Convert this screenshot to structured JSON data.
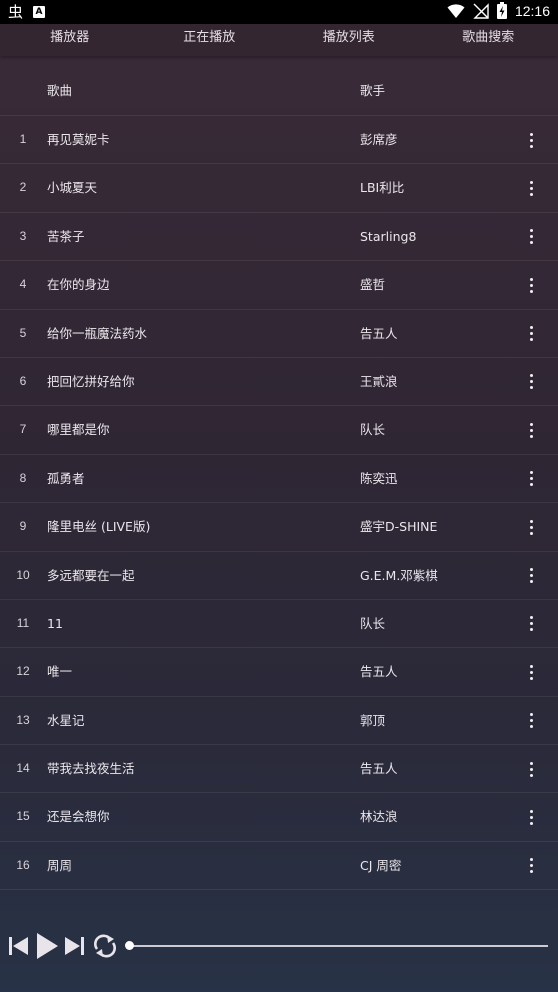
{
  "status_bar": {
    "time": "12:16",
    "app_glyph": "虫",
    "notif_letter": "A"
  },
  "tabs": [
    {
      "label": "播放器"
    },
    {
      "label": "正在播放"
    },
    {
      "label": "播放列表"
    },
    {
      "label": "歌曲搜索"
    }
  ],
  "table": {
    "header": {
      "song": "歌曲",
      "artist": "歌手"
    },
    "rows": [
      {
        "index": "1",
        "song": "再见莫妮卡",
        "artist": "彭席彦"
      },
      {
        "index": "2",
        "song": "小城夏天",
        "artist": "LBI利比"
      },
      {
        "index": "3",
        "song": "苦茶子",
        "artist": "Starling8"
      },
      {
        "index": "4",
        "song": "在你的身边",
        "artist": "盛哲"
      },
      {
        "index": "5",
        "song": "给你一瓶魔法药水",
        "artist": "告五人"
      },
      {
        "index": "6",
        "song": "把回忆拼好给你",
        "artist": "王貳浪"
      },
      {
        "index": "7",
        "song": "哪里都是你",
        "artist": "队长"
      },
      {
        "index": "8",
        "song": "孤勇者",
        "artist": "陈奕迅"
      },
      {
        "index": "9",
        "song": "隆里电丝 (LIVE版)",
        "artist": "盛宇D-SHINE"
      },
      {
        "index": "10",
        "song": "多远都要在一起",
        "artist": "G.E.M.邓紫棋"
      },
      {
        "index": "11",
        "song": "11",
        "artist": "队长"
      },
      {
        "index": "12",
        "song": "唯一",
        "artist": "告五人"
      },
      {
        "index": "13",
        "song": "水星记",
        "artist": "郭顶"
      },
      {
        "index": "14",
        "song": "带我去找夜生活",
        "artist": "告五人"
      },
      {
        "index": "15",
        "song": "还是会想你",
        "artist": "林达浪"
      },
      {
        "index": "16",
        "song": "周周",
        "artist": "CJ 周密"
      }
    ]
  },
  "player": {
    "progress": 0.0,
    "icons": [
      "skip-previous-icon",
      "play-icon",
      "skip-next-icon",
      "repeat-icon"
    ]
  },
  "colors": {
    "background_top": "#3a2b37",
    "background_bottom": "#283246",
    "text": "#e9e4ea"
  }
}
